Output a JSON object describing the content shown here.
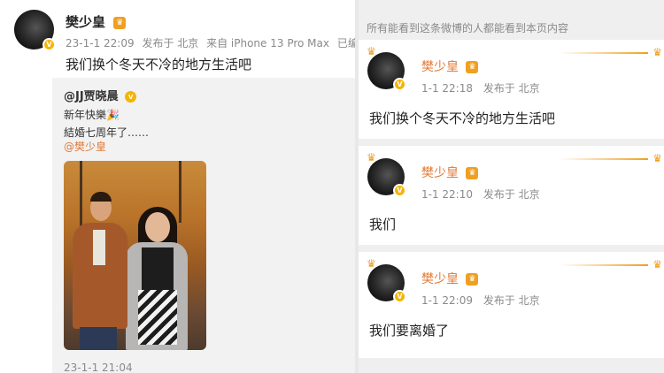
{
  "left_post": {
    "username": "樊少皇",
    "date": "23-1-1 22:09",
    "location": "发布于 北京",
    "device": "来自 iPhone 13 Pro Max",
    "edited": "已编辑",
    "text": "我们换个冬天不冷的地方生活吧",
    "repost": {
      "author": "@JJ贾晓晨",
      "line1": "新年快樂🎉",
      "line2": "結婚七周年了……",
      "mention": "@樊少皇",
      "time": "23-1-1 21:04"
    }
  },
  "right_feed": {
    "visibility_note": "所有能看到这条微博的人都能看到本页内容",
    "posts": [
      {
        "name": "樊少皇",
        "time": "1-1 22:18",
        "location": "发布于 北京",
        "text": "我们换个冬天不冷的地方生活吧"
      },
      {
        "name": "樊少皇",
        "time": "1-1 22:10",
        "location": "发布于 北京",
        "text": "我们"
      },
      {
        "name": "樊少皇",
        "time": "1-1 22:09",
        "location": "发布于 北京",
        "text": "我们要离婚了"
      }
    ]
  },
  "icons": {
    "verified_badge": "V",
    "level_crown": "♛"
  },
  "colors": {
    "accent_orange": "#e07a37",
    "verified_gold": "#f6b400"
  }
}
